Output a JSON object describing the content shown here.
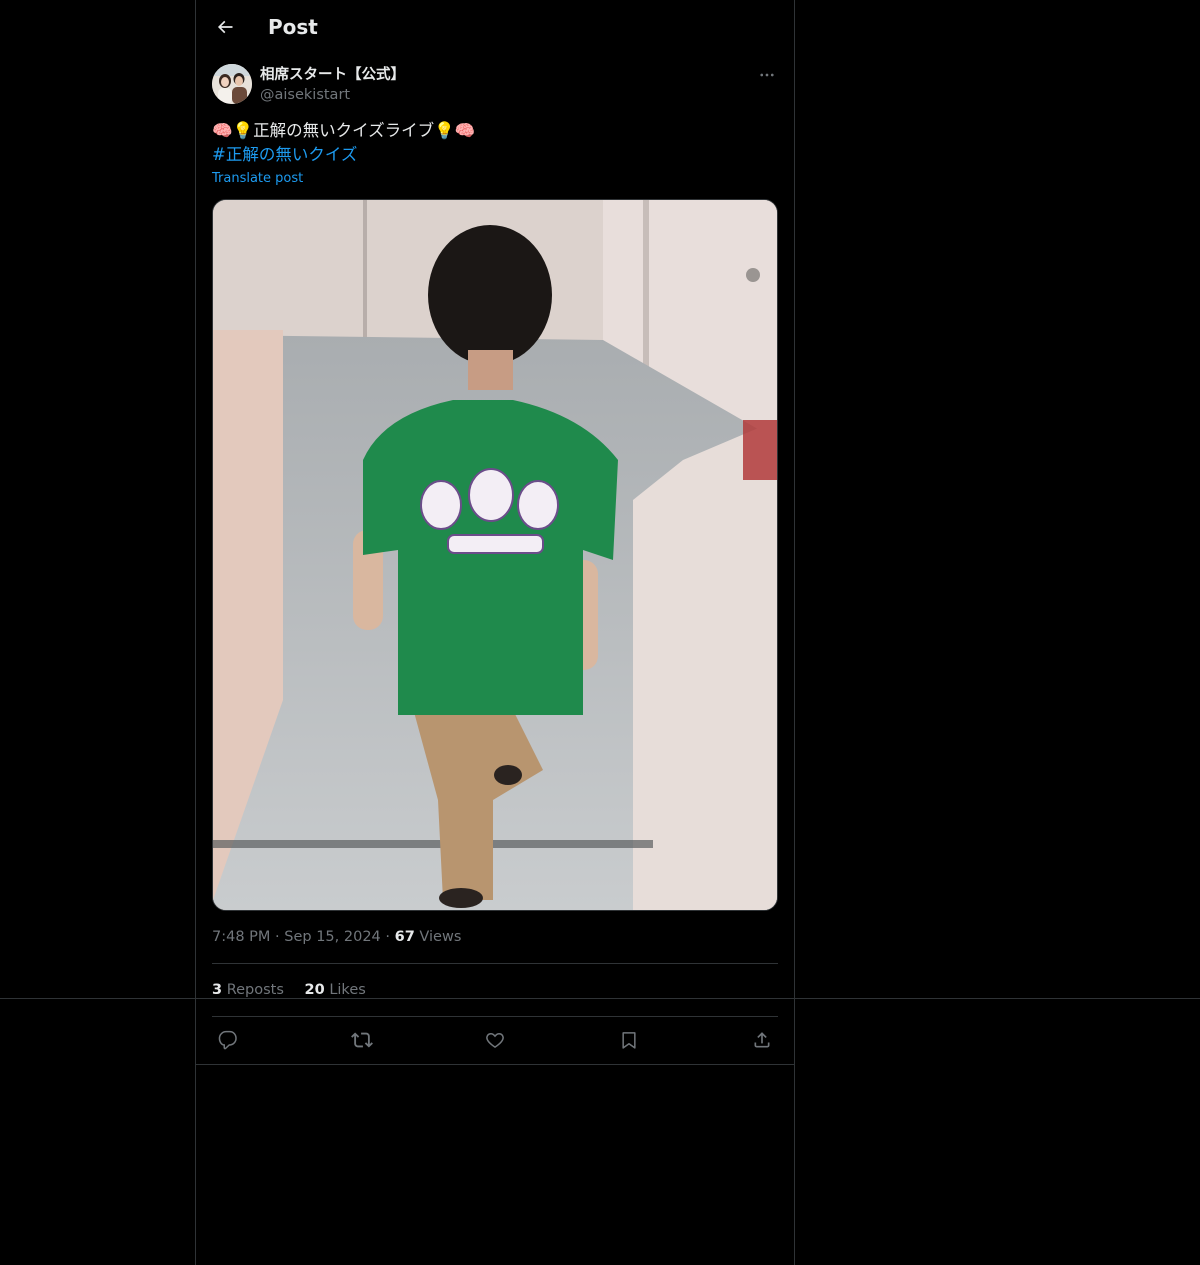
{
  "header": {
    "title": "Post",
    "back_icon": "arrow-left-icon"
  },
  "author": {
    "display_name": "相席スタート【公式】",
    "handle": "@aisekistart",
    "more_icon": "more-horizontal-icon"
  },
  "post": {
    "text": "🧠💡正解の無いクイズライブ💡🧠",
    "hashtag": "#正解の無いクイズ",
    "translate_label": "Translate post",
    "image_description_icon": "photo"
  },
  "meta": {
    "time": "7:48 PM",
    "date": "Sep 15, 2024",
    "views_count": "67",
    "views_label": "Views",
    "separator": "·"
  },
  "stats": {
    "reposts_count": "3",
    "reposts_label": "Reposts",
    "likes_count": "20",
    "likes_label": "Likes"
  },
  "actions": {
    "reply_icon": "reply-icon",
    "repost_icon": "repost-icon",
    "like_icon": "heart-icon",
    "bookmark_icon": "bookmark-icon",
    "share_icon": "share-icon"
  },
  "colors": {
    "background": "#000000",
    "text_primary": "#e7e9ea",
    "text_secondary": "#71767b",
    "accent": "#1d9bf0",
    "border": "#2f3336",
    "shirt_green": "#1f8a4c"
  }
}
